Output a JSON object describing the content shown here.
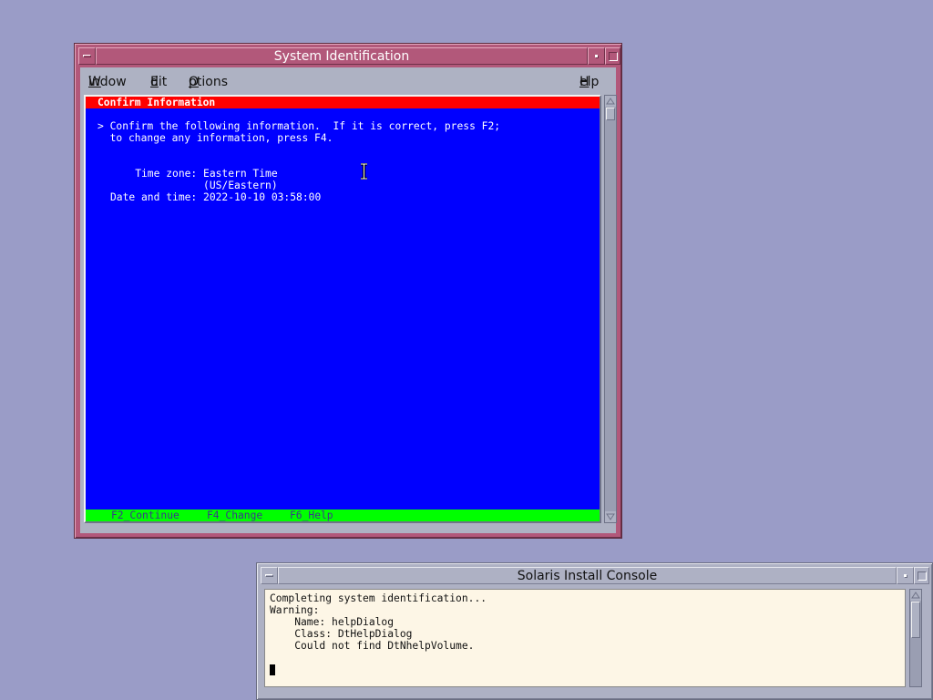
{
  "main_window": {
    "title": "System Identification",
    "menu": {
      "window": "Window",
      "edit": "Edit",
      "options": "Options",
      "help": "Help"
    },
    "screen": {
      "header": "Confirm Information",
      "lines": [
        "> Confirm the following information.  If it is correct, press F2;",
        "  to change any information, press F4.",
        "    Time zone: Eastern Time",
        "               (US/Eastern)",
        "Date and time: 2022-10-10 03:58:00"
      ],
      "function_keys": {
        "continue": "F2_Continue",
        "change": "F4_Change",
        "help": "F6_Help"
      }
    }
  },
  "console_window": {
    "title": "Solaris Install Console",
    "lines": [
      "Completing system identification...",
      "Warning:",
      "    Name: helpDialog",
      "    Class: DtHelpDialog",
      "    Could not find DtNhelpVolume."
    ]
  },
  "colors": {
    "desktop": "#9a9cc7",
    "active_frame": "#b2587a",
    "terminal_bg": "#0000ff",
    "terminal_header": "#ff0000",
    "terminal_footer": "#00ff00",
    "console_bg": "#fdf6e6"
  }
}
